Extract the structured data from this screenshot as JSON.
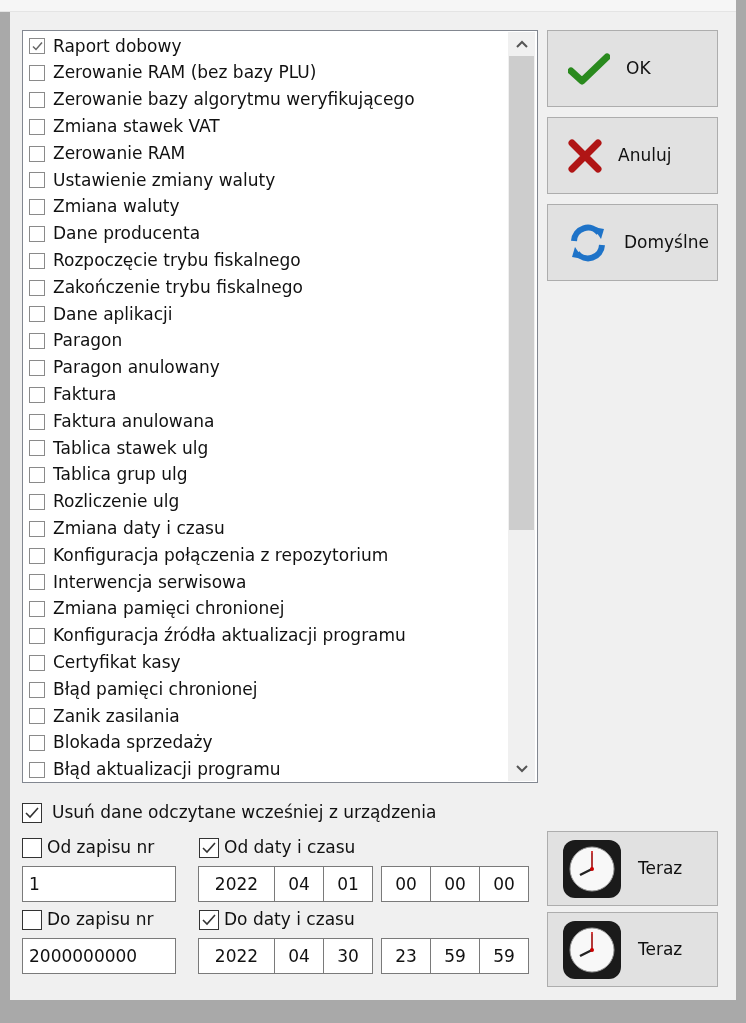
{
  "events": [
    {
      "label": "Raport dobowy",
      "checked": true
    },
    {
      "label": "Zerowanie RAM (bez bazy PLU)",
      "checked": false
    },
    {
      "label": "Zerowanie bazy algorytmu weryfikującego",
      "checked": false
    },
    {
      "label": "Zmiana stawek VAT",
      "checked": false
    },
    {
      "label": "Zerowanie RAM",
      "checked": false
    },
    {
      "label": "Ustawienie zmiany waluty",
      "checked": false
    },
    {
      "label": "Zmiana waluty",
      "checked": false
    },
    {
      "label": "Dane producenta",
      "checked": false
    },
    {
      "label": "Rozpoczęcie trybu fiskalnego",
      "checked": false
    },
    {
      "label": "Zakończenie trybu fiskalnego",
      "checked": false
    },
    {
      "label": "Dane aplikacji",
      "checked": false
    },
    {
      "label": "Paragon",
      "checked": false
    },
    {
      "label": "Paragon anulowany",
      "checked": false
    },
    {
      "label": "Faktura",
      "checked": false
    },
    {
      "label": "Faktura anulowana",
      "checked": false
    },
    {
      "label": "Tablica stawek ulg",
      "checked": false
    },
    {
      "label": "Tablica grup ulg",
      "checked": false
    },
    {
      "label": "Rozliczenie ulg",
      "checked": false
    },
    {
      "label": "Zmiana daty i czasu",
      "checked": false
    },
    {
      "label": "Konfiguracja połączenia z repozytorium",
      "checked": false
    },
    {
      "label": "Interwencja serwisowa",
      "checked": false
    },
    {
      "label": "Zmiana pamięci chronionej",
      "checked": false
    },
    {
      "label": "Konfiguracja źródła aktualizacji programu",
      "checked": false
    },
    {
      "label": "Certyfikat kasy",
      "checked": false
    },
    {
      "label": "Błąd pamięci chronionej",
      "checked": false
    },
    {
      "label": "Zanik zasilania",
      "checked": false
    },
    {
      "label": "Blokada sprzedaży",
      "checked": false
    },
    {
      "label": "Błąd aktualizacji programu",
      "checked": false
    }
  ],
  "buttons": [
    {
      "label": "OK",
      "kind": "ok"
    },
    {
      "label": "Anuluj",
      "kind": "cancel"
    },
    {
      "label": "Domyślne",
      "kind": "defaults"
    }
  ],
  "delete_previous": {
    "label": "Usuń dane odczytane wcześniej z urządzenia",
    "checked": true
  },
  "ranges": [
    {
      "record_label": "Od zapisu nr",
      "record_checked": false,
      "record_value": "1",
      "datetime_label": "Od daty i czasu",
      "datetime_checked": true,
      "date": [
        "2022",
        "04",
        "01"
      ],
      "time": [
        "00",
        "00",
        "00"
      ],
      "now_button": "Teraz"
    },
    {
      "record_label": "Do zapisu nr",
      "record_checked": false,
      "record_value": "2000000000",
      "datetime_label": "Do daty i czasu",
      "datetime_checked": true,
      "date": [
        "2022",
        "04",
        "30"
      ],
      "time": [
        "23",
        "59",
        "59"
      ],
      "now_button": "Teraz"
    }
  ]
}
